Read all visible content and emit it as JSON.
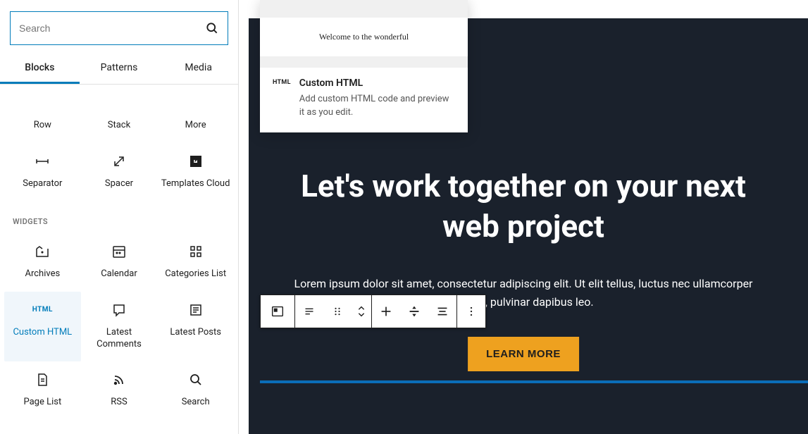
{
  "search": {
    "placeholder": "Search"
  },
  "tabs": {
    "blocks": "Blocks",
    "patterns": "Patterns",
    "media": "Media"
  },
  "design_blocks": {
    "row": "Row",
    "stack": "Stack",
    "more": "More",
    "separator": "Separator",
    "spacer": "Spacer",
    "templates_cloud": "Templates Cloud"
  },
  "sections": {
    "widgets": "Widgets"
  },
  "widget_blocks": {
    "archives": "Archives",
    "calendar": "Calendar",
    "categories_list": "Categories List",
    "custom_html": "Custom HTML",
    "latest_comments": "Latest Comments",
    "latest_posts": "Latest Posts",
    "page_list": "Page List",
    "rss": "RSS",
    "search": "Search"
  },
  "preview": {
    "banner_text": "Welcome to the wonderful",
    "badge": "HTML",
    "title": "Custom HTML",
    "description": "Add custom HTML code and preview it as you edit."
  },
  "hero": {
    "title": "Let's work together on your next web project",
    "text": "Lorem ipsum dolor sit amet, consectetur adipiscing elit. Ut elit tellus, luctus nec ullamcorper mattis, pulvinar dapibus leo.",
    "cta": "LEARN MORE"
  },
  "icon_labels": {
    "html": "HTML"
  }
}
